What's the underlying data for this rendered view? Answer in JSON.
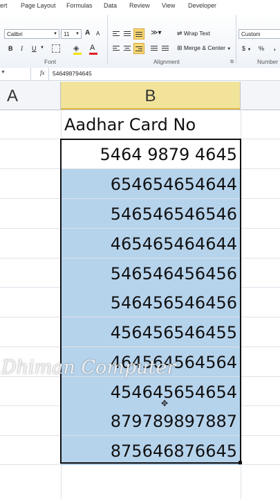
{
  "ribbon": {
    "tabs": [
      "ert",
      "Page Layout",
      "Formulas",
      "Data",
      "Review",
      "View",
      "Developer"
    ],
    "font_name": "Calibri",
    "font_size": "11",
    "bold": "B",
    "italic": "I",
    "underline": "U",
    "font_color_letter": "A",
    "grow_font": "A",
    "shrink_font": "A",
    "wrap_text": "Wrap Text",
    "merge_center": "Merge & Center",
    "number_format": "Custom",
    "currency": "$",
    "percent": "%",
    "comma": ",",
    "groups": {
      "font": "Font",
      "alignment": "Alignment",
      "number": "Number"
    }
  },
  "formula_bar": {
    "fx": "fx",
    "value": "546498794645"
  },
  "columns": {
    "a": "A",
    "b": "B"
  },
  "sheet": {
    "header": "Aadhar Card No",
    "rows": [
      "5464 9879 4645",
      "654654654644",
      "546546546546",
      "465465464644",
      "546546456456",
      "546456546456",
      "456456546455",
      "464564564564",
      "454645654654",
      "879789897887",
      "875646876645"
    ]
  },
  "watermark": "Dhiman Computer",
  "colors": {
    "selection": "#b6d3ec",
    "column_b_header": "#f2e39b",
    "highlight_button": "#f7d774"
  }
}
